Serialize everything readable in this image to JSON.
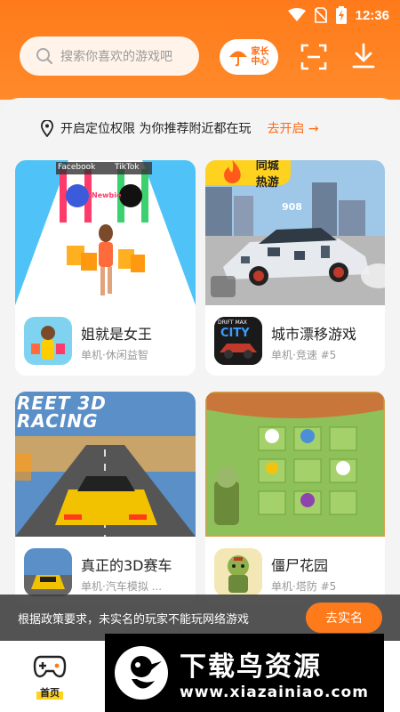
{
  "status_bar": {
    "time": "12:36"
  },
  "header": {
    "search_placeholder": "搜索你喜欢的游戏吧",
    "parent_center_label": "家长中心"
  },
  "location_banner": {
    "text": "开启定位权限 为你推荐附近都在玩",
    "action": "去开启"
  },
  "games": [
    {
      "title": "姐就是女王",
      "meta": "单机·休闲益智",
      "thumb_labels": [
        "Facebook",
        "TikTok",
        "Newbie"
      ]
    },
    {
      "title": "城市漂移游戏",
      "meta": "单机·竞速 #5",
      "badge": "同城热游",
      "icon_text": [
        "DRIFT MAX",
        "CITY"
      ],
      "thumb_label": "908"
    },
    {
      "title": "真正的3D赛车",
      "meta": "单机·汽车模拟 ...",
      "thumb_label": "REET 3D RACING"
    },
    {
      "title": "僵尸花园",
      "meta": "单机·塔防 #5"
    }
  ],
  "notice": {
    "text": "根据政策要求，未实名的玩家不能玩网络游戏",
    "button": "去实名"
  },
  "bottom_nav": {
    "home_label": "首页"
  },
  "watermark": {
    "main": "下载鸟资源",
    "url": "www.xiazainiao.com"
  },
  "colors": {
    "brand_orange": "#ff7a1a",
    "badge_yellow": "#ffd21f"
  }
}
